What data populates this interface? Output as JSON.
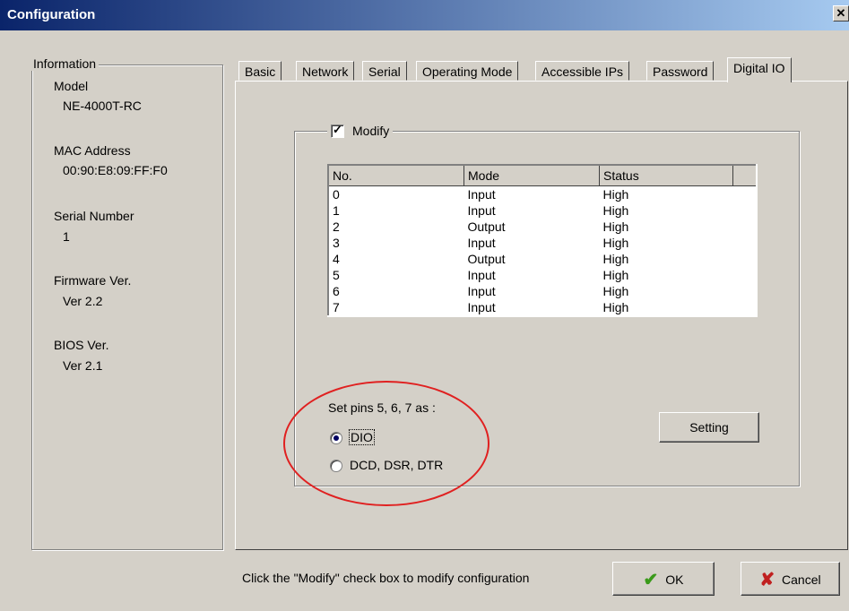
{
  "window": {
    "title": "Configuration",
    "close_symbol": "✕"
  },
  "info": {
    "legend": "Information",
    "model_label": "Model",
    "model_value": "NE-4000T-RC",
    "mac_label": "MAC Address",
    "mac_value": "00:90:E8:09:FF:F0",
    "serial_label": "Serial Number",
    "serial_value": "1",
    "firmware_label": "Firmware Ver.",
    "firmware_value": "Ver 2.2",
    "bios_label": "BIOS Ver.",
    "bios_value": "Ver 2.1"
  },
  "tabs": [
    "Basic",
    "Network",
    "Serial",
    "Operating Mode",
    "Accessible IPs",
    "Password",
    "Digital IO"
  ],
  "active_tab": "Digital IO",
  "digital_io": {
    "modify_label": "Modify",
    "modify_checked": true,
    "columns": [
      "No.",
      "Mode",
      "Status"
    ],
    "rows": [
      [
        "0",
        "Input",
        "High"
      ],
      [
        "1",
        "Input",
        "High"
      ],
      [
        "2",
        "Output",
        "High"
      ],
      [
        "3",
        "Input",
        "High"
      ],
      [
        "4",
        "Output",
        "High"
      ],
      [
        "5",
        "Input",
        "High"
      ],
      [
        "6",
        "Input",
        "High"
      ],
      [
        "7",
        "Input",
        "High"
      ]
    ],
    "set_pins_label": "Set pins 5, 6, 7 as :",
    "option_dio": "DIO",
    "option_dcd": "DCD, DSR, DTR",
    "selected_option": "DIO",
    "setting_button": "Setting"
  },
  "footer": {
    "hint": "Click the \"Modify\" check box to modify configuration",
    "ok_label": "OK",
    "cancel_label": "Cancel"
  },
  "colors": {
    "title_start": "#0a246a",
    "title_end": "#a6caf0",
    "annotation_ellipse": "#e02020",
    "ok_check": "#3a9a1a",
    "cancel_x": "#c02020"
  }
}
